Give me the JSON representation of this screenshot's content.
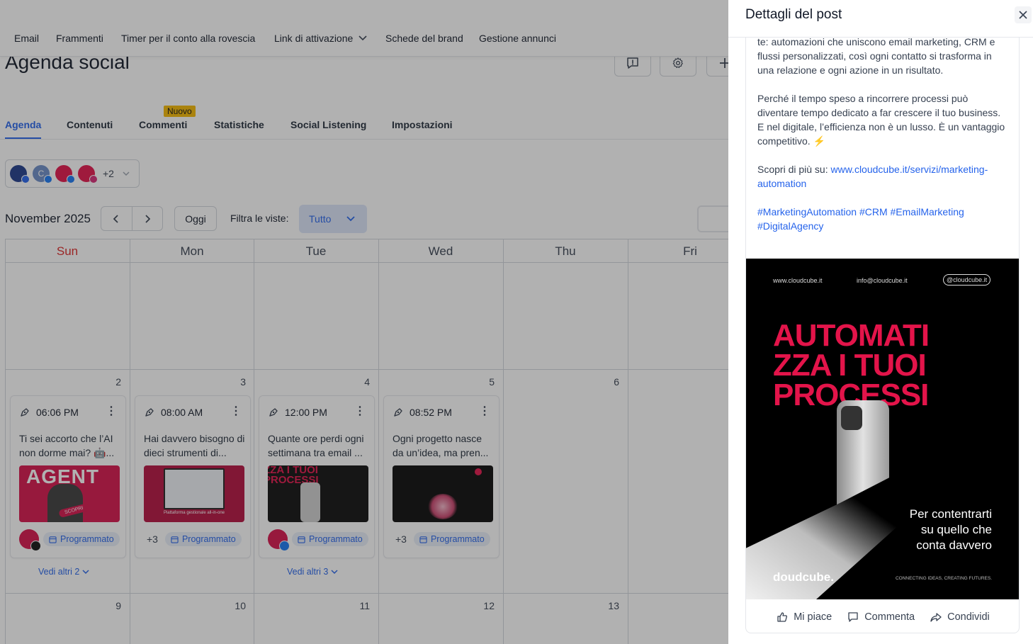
{
  "topnav": {
    "items": [
      "Email",
      "Frammenti",
      "Timer per il conto alla rovescia",
      "Link di attivazione",
      "Schede del brand",
      "Gestione annunci"
    ]
  },
  "page": {
    "title": "Agenda social"
  },
  "tabs": {
    "items": [
      "Agenda",
      "Contenuti",
      "Commenti",
      "Statistiche",
      "Social Listening",
      "Impostazioni"
    ],
    "new_badge": "Nuovo"
  },
  "accounts": {
    "extra_count": "+2"
  },
  "calendar": {
    "month_label": "November 2025",
    "today_label": "Oggi",
    "filter_label": "Filtra le viste:",
    "filter_value": "Tutto",
    "weekdays": [
      "Sun",
      "Mon",
      "Tue",
      "Wed",
      "Thu",
      "Fri"
    ],
    "week2_days": [
      "2",
      "3",
      "4",
      "5",
      "6"
    ],
    "week3_days": [
      "9",
      "10",
      "11",
      "12",
      "13"
    ],
    "posts": [
      {
        "time": "06:06 PM",
        "text": "Ti sei accorto che l’AI non dorme mai? 🤖...",
        "status": "Programmato",
        "thumb_text": "AGENT",
        "thumb_badge": "SCOPRI"
      },
      {
        "time": "08:00 AM",
        "text": "Hai davvero bisogno di dieci strumenti di...",
        "status": "Programmato",
        "more": "+3",
        "thumb_text": "Piattaforma gestionale all-in-one"
      },
      {
        "time": "12:00 PM",
        "text": "Quante ore perdi ogni settimana tra email ...",
        "status": "Programmato",
        "thumb_text": "ZZA I TUOI PROCESSI"
      },
      {
        "time": "08:52 PM",
        "text": "Ogni progetto nasce da un’idea, ma pren...",
        "status": "Programmato",
        "more": "+3"
      }
    ],
    "see_more": [
      "Vedi altri 2",
      "Vedi altri 3"
    ]
  },
  "panel": {
    "title": "Dettagli del post",
    "text_lines": [
      "te: automazioni che uniscono email marketing, CRM e flussi personalizzati, così ogni contatto si trasforma in una relazione e ogni azione in un risultato.",
      "",
      "Perché il tempo speso a rincorrere processi può diventare tempo dedicato a far crescere il tuo business.",
      "E nel digitale, l’efficienza non è un lusso. È un vantaggio competitivo. ⚡",
      "",
      "Scopri di più su: "
    ],
    "link": "www.cloudcube.it/servizi/marketing-automation",
    "hashtags": "#MarketingAutomation #CRM #EmailMarketing #DigitalAgency",
    "image": {
      "top_left": "www.cloudcube.it",
      "top_mid": "info@cloudcube.it",
      "top_right": "@cloudcube.it",
      "headline": [
        "AUTOMATI",
        "ZZA I TUOI",
        "PROCESSI"
      ],
      "tagline": [
        "Per contentrarti",
        "su quello che",
        "conta davvero"
      ],
      "logo": "doudcube.",
      "footer": "CONNECTING IDEAS, CREATING FUTURES."
    },
    "actions": {
      "like": "Mi piace",
      "comment": "Commenta",
      "share": "Condividi"
    }
  },
  "colors": {
    "accent": "#2563eb",
    "brand_red": "#e3144a",
    "sunday": "#dc2626",
    "badge": "#f5b800"
  }
}
